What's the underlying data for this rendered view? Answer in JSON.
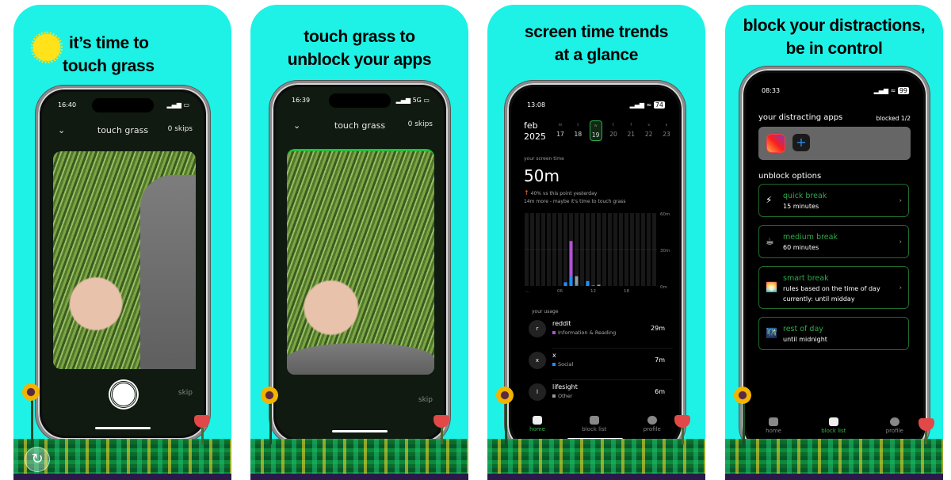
{
  "colors": {
    "background": "#1ef2e6",
    "accent_green": "#2fa84a",
    "screen_bg": "#000000"
  },
  "panels": [
    {
      "headline": [
        "it’s time to",
        "touch grass"
      ],
      "icon": "sun-icon",
      "status_time": "16:40",
      "header_title": "touch grass",
      "skips": "0 skips",
      "skip_label": "skip"
    },
    {
      "headline": [
        "touch grass to",
        "unblock your apps"
      ],
      "status_time": "16:39",
      "network": "5G",
      "header_title": "touch grass",
      "skips": "0 skips",
      "skip_label": "skip"
    },
    {
      "headline": [
        "screen time trends",
        "at a glance"
      ],
      "status_time": "13:08",
      "battery": "74",
      "month": "feb",
      "year": "2025",
      "days": [
        {
          "dow": "m",
          "day": "17"
        },
        {
          "dow": "t",
          "day": "18"
        },
        {
          "dow": "w",
          "day": "19",
          "selected": true
        },
        {
          "dow": "t",
          "day": "20"
        },
        {
          "dow": "f",
          "day": "21"
        },
        {
          "dow": "s",
          "day": "22"
        },
        {
          "dow": "s",
          "day": "23"
        }
      ],
      "screen_time_label": "your screen time",
      "screen_time": "50m",
      "comparison": "40% vs this point yesterday",
      "note": "14m more - maybe it's time to touch grass",
      "usage_label": "your usage",
      "usage": [
        {
          "initial": "r",
          "name": "reddit",
          "category": "Information & Reading",
          "color": "#b44fd8",
          "time": "29m"
        },
        {
          "initial": "x",
          "name": "x",
          "category": "Social",
          "color": "#1e90ff",
          "time": "7m"
        },
        {
          "initial": "l",
          "name": "lifesight",
          "category": "Other",
          "color": "#9a9a9a",
          "time": "6m"
        }
      ],
      "tabs": [
        {
          "label": "home",
          "active": true
        },
        {
          "label": "block list"
        },
        {
          "label": "profile"
        }
      ]
    },
    {
      "headline": [
        "block your distractions,",
        "be in control"
      ],
      "status_time": "08:33",
      "battery": "99",
      "apps_title": "your distracting apps",
      "blocked": "blocked 1/2",
      "unblock_title": "unblock options",
      "options": [
        {
          "icon": "⚡",
          "title": "quick break",
          "lines": [
            "15 minutes"
          ]
        },
        {
          "icon": "☕",
          "title": "medium break",
          "lines": [
            "60 minutes"
          ]
        },
        {
          "icon": "🌅",
          "title": "smart break",
          "lines": [
            "rules based on the time of day",
            "currently: until midday"
          ]
        },
        {
          "icon": "🌃",
          "title": "rest of day",
          "lines": [
            "until midnight"
          ]
        }
      ],
      "tabs": [
        {
          "label": "home"
        },
        {
          "label": "block list",
          "active": true
        },
        {
          "label": "profile"
        }
      ]
    }
  ],
  "chart_data": {
    "type": "bar",
    "stacked": true,
    "categories": [
      "00",
      "01",
      "02",
      "03",
      "04",
      "05",
      "06",
      "07",
      "08",
      "09",
      "10",
      "11",
      "12",
      "13",
      "14",
      "15",
      "16",
      "17",
      "18",
      "19",
      "20",
      "21",
      "22",
      "23"
    ],
    "x_tick_labels": [
      "...",
      "06",
      "12",
      "18"
    ],
    "y_tick_labels": [
      "0m",
      "30m",
      "60m"
    ],
    "ylim": [
      0,
      60
    ],
    "series": [
      {
        "name": "Social",
        "color": "#1e90ff",
        "values": [
          0,
          0,
          0,
          0,
          0,
          0,
          0,
          3,
          8,
          1,
          0,
          4,
          0.5,
          0,
          0,
          0,
          0,
          0,
          0,
          0,
          0,
          0,
          0,
          0
        ]
      },
      {
        "name": "Information & Reading",
        "color": "#b44fd8",
        "values": [
          0,
          0,
          0,
          0,
          0,
          0,
          0,
          0,
          29,
          0,
          0,
          0,
          0,
          0,
          0,
          0,
          0,
          0,
          0,
          0,
          0,
          0,
          0,
          0
        ]
      },
      {
        "name": "Other",
        "color": "#9a9a9a",
        "values": [
          0,
          0,
          0,
          0,
          0,
          0,
          0,
          0,
          0,
          7,
          0,
          0,
          0,
          1,
          0,
          0,
          0,
          0,
          0,
          0,
          0,
          0,
          0,
          0
        ]
      }
    ]
  }
}
